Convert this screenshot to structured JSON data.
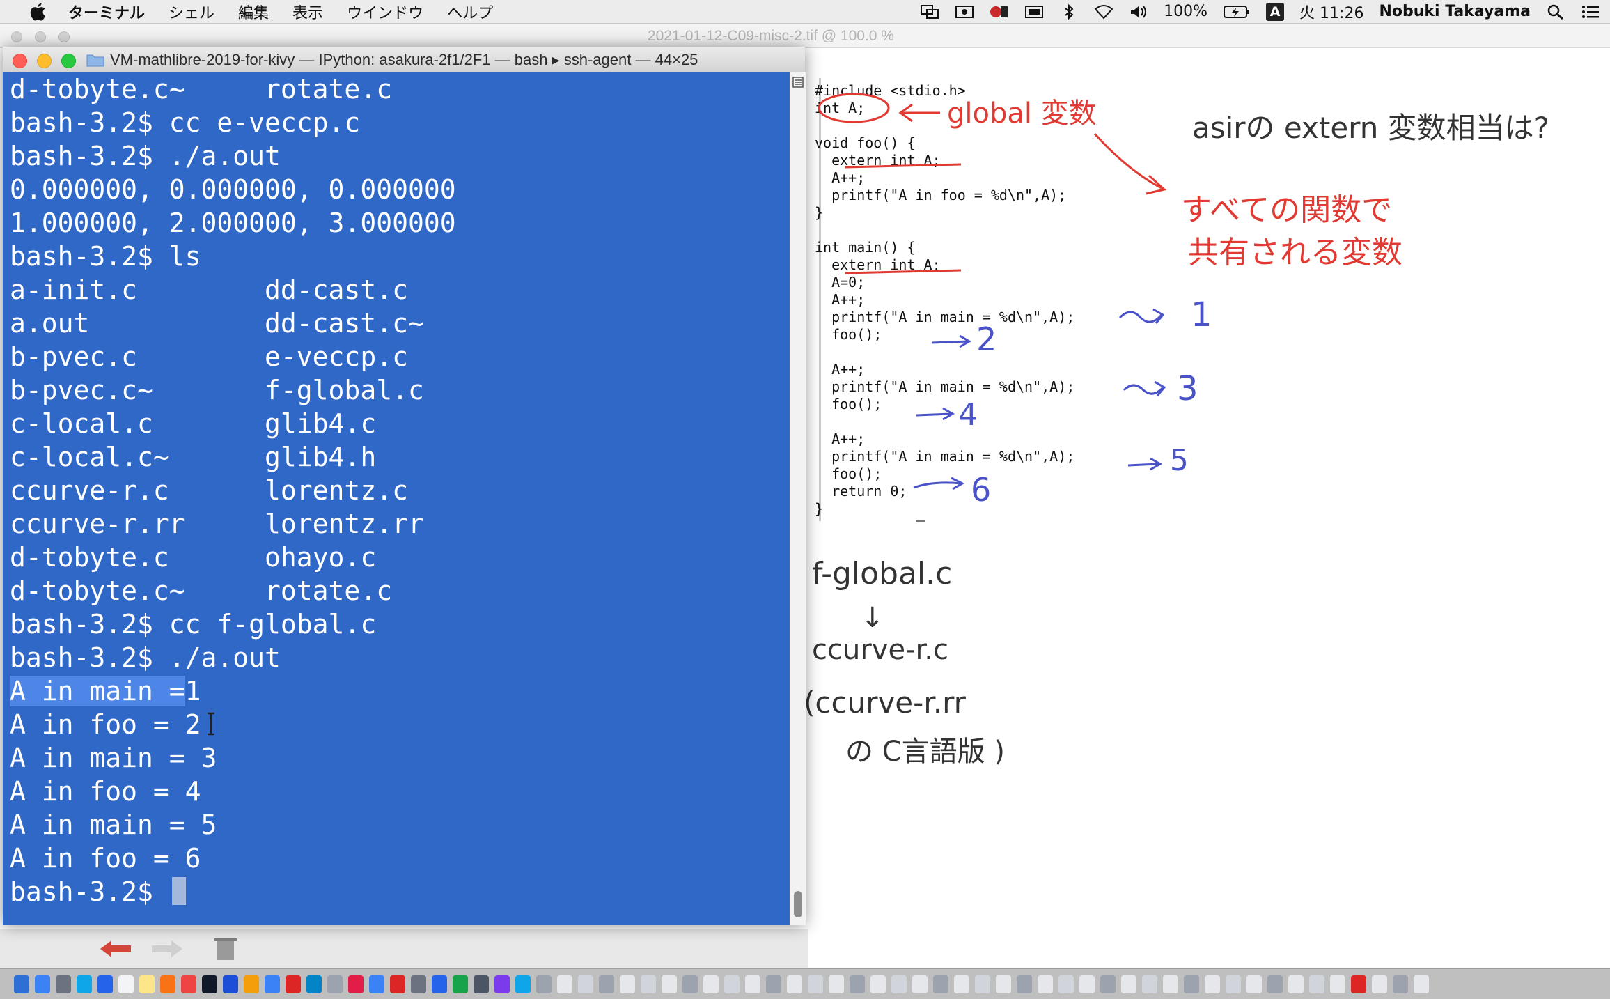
{
  "menubar": {
    "app_name": "ターミナル",
    "items": [
      "シェル",
      "編集",
      "表示",
      "ウインドウ",
      "ヘルプ"
    ],
    "battery_text": "100%",
    "ime_label": "A",
    "clock": "火 11:26",
    "user_name": "Nobuki Takayama"
  },
  "viewer": {
    "title": "2021-01-12-C09-misc-2.tif @ 100.0 %"
  },
  "terminal": {
    "title": "VM-mathlibre-2019-for-kivy — IPython: asakura-2f1/2F1 — bash ▸ ssh-agent — 44×25",
    "lines": [
      "d-tobyte.c~     rotate.c",
      "bash-3.2$ cc e-veccp.c",
      "bash-3.2$ ./a.out",
      "0.000000, 0.000000, 0.000000",
      "1.000000, 2.000000, 3.000000",
      "bash-3.2$ ls",
      "a-init.c        dd-cast.c",
      "a.out           dd-cast.c~",
      "b-pvec.c        e-veccp.c",
      "b-pvec.c~       f-global.c",
      "c-local.c       glib4.c",
      "c-local.c~      glib4.h",
      "ccurve-r.c      lorentz.c",
      "ccurve-r.rr     lorentz.rr",
      "d-tobyte.c      ohayo.c",
      "d-tobyte.c~     rotate.c",
      "bash-3.2$ cc f-global.c",
      "bash-3.2$ ./a.out",
      "A in main = 1",
      "A in foo = 2",
      "A in main = 3",
      "A in foo = 4",
      "A in main = 5",
      "A in foo = 6",
      "bash-3.2$ "
    ],
    "highlight_line_text": "A in main =",
    "highlight_line_rest": "1",
    "colors": {
      "background": "#3068c8",
      "selection": "#4d86e6"
    }
  },
  "code": {
    "lines": [
      "#include <stdio.h>",
      "int A;",
      "",
      "void foo() {",
      "  extern int A;",
      "  A++;",
      "  printf(\"A in foo = %d\\n\",A);",
      "}",
      "",
      "int main() {",
      "  extern int A;",
      "  A=0;",
      "  A++;",
      "  printf(\"A in main = %d\\n\",A);",
      "  foo();",
      "",
      "  A++;",
      "  printf(\"A in main = %d\\n\",A);",
      "  foo();",
      "",
      "  A++;",
      "  printf(\"A in main = %d\\n\",A);",
      "  foo();",
      "  return 0;",
      "}"
    ]
  },
  "annotations": {
    "global_label": "global 変数",
    "question": "asirの extern 変数相当は?",
    "shared_line1": "すべての関数で",
    "shared_line2": "共有される変数",
    "out1": "1",
    "out2": "2",
    "out3": "3",
    "out4": "4",
    "out5": "5",
    "out6": "6",
    "file1": "f-global.c",
    "arrow_down": "↓",
    "file2": "ccurve-r.c",
    "file3": "(ccurve-r.rr",
    "file3_note": "の C言語版 )",
    "red_color": "#e03a33",
    "blue_color": "#4a52c8"
  }
}
